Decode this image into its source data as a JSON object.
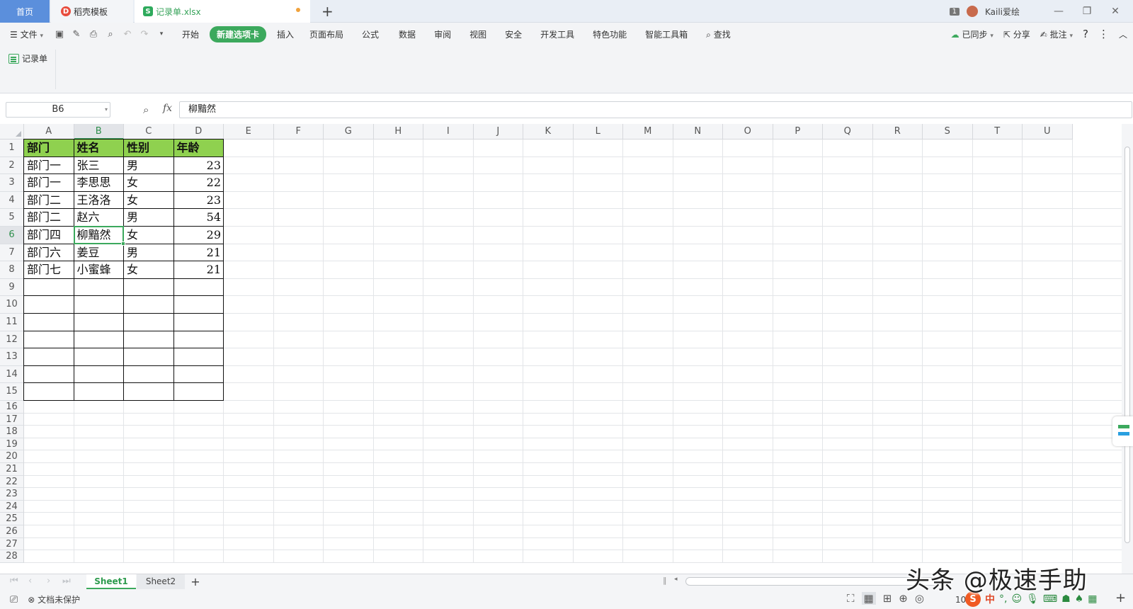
{
  "titlebar": {
    "tabs": [
      {
        "label": "首页"
      },
      {
        "label": "稻壳模板"
      },
      {
        "label": "记录单.xlsx"
      }
    ],
    "new_tab": "+",
    "window_count": "1",
    "user": "Kaili爱绘"
  },
  "menubar": {
    "file": "文件",
    "items": [
      "开始",
      "新建选项卡",
      "插入",
      "页面布局",
      "公式",
      "数据",
      "审阅",
      "视图",
      "安全",
      "开发工具",
      "特色功能",
      "智能工具箱",
      "查找"
    ],
    "active": "新建选项卡",
    "right": {
      "sync": "已同步",
      "share": "分享",
      "comment": "批注",
      "help": "?"
    }
  },
  "ribbon": {
    "record_form": "记录单"
  },
  "formula_bar": {
    "cell_ref": "B6",
    "fx": "fx",
    "value": "柳黯然"
  },
  "grid": {
    "columns": [
      "A",
      "B",
      "C",
      "D",
      "E",
      "F",
      "G",
      "H",
      "I",
      "J",
      "K",
      "L",
      "M",
      "N",
      "O",
      "P",
      "Q",
      "R",
      "S",
      "T",
      "U"
    ],
    "selected_column": "B",
    "selected_row": 6,
    "rows": [
      [
        "部门",
        "姓名",
        "性别",
        "年龄"
      ],
      [
        "部门一",
        "张三",
        "男",
        "23"
      ],
      [
        "部门一",
        "李思思",
        "女",
        "22"
      ],
      [
        "部门二",
        "王洛洛",
        "女",
        "23"
      ],
      [
        "部门二",
        "赵六",
        "男",
        "54"
      ],
      [
        "部门四",
        "柳黯然",
        "女",
        "29"
      ],
      [
        "部门六",
        "姜豆",
        "男",
        "21"
      ],
      [
        "部门七",
        "小蜜蜂",
        "女",
        "21"
      ]
    ],
    "header_color": "#8fd14f"
  },
  "sheets": {
    "tabs": [
      "Sheet1",
      "Sheet2"
    ],
    "active": "Sheet1",
    "add": "+"
  },
  "status": {
    "protect": "文档未保护",
    "zoom": "10",
    "ime": "中"
  },
  "watermark": "头条 @极速手助",
  "colors": {
    "accent": "#3ca95d",
    "home_tab": "#5b8fdc"
  }
}
